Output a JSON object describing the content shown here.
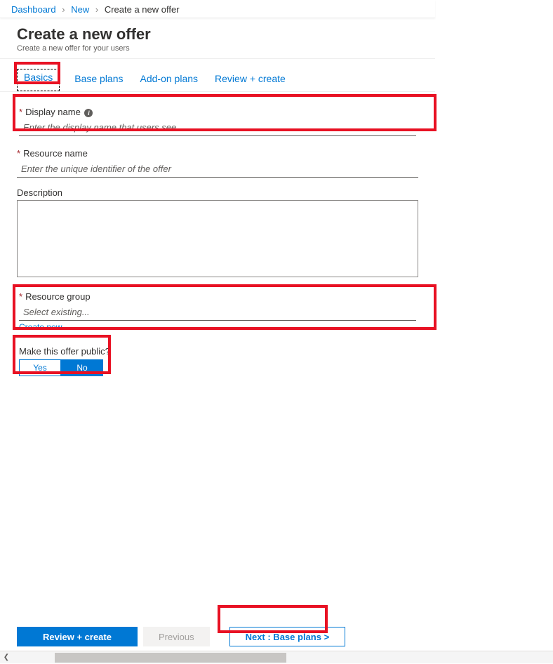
{
  "breadcrumb": {
    "items": [
      "Dashboard",
      "New",
      "Create a new offer"
    ]
  },
  "header": {
    "title": "Create a new offer",
    "subtitle": "Create a new offer for your users"
  },
  "tabs": [
    "Basics",
    "Base plans",
    "Add-on plans",
    "Review + create"
  ],
  "form": {
    "displayName": {
      "label": "Display name",
      "placeholder": "Enter the display name that users see"
    },
    "resourceName": {
      "label": "Resource name",
      "placeholder": "Enter the unique identifier of the offer"
    },
    "description": {
      "label": "Description"
    },
    "resourceGroup": {
      "label": "Resource group",
      "placeholder": "Select existing...",
      "createNew": "Create new"
    },
    "makePublic": {
      "label": "Make this offer public?",
      "yes": "Yes",
      "no": "No"
    }
  },
  "footer": {
    "review": "Review + create",
    "previous": "Previous",
    "next": "Next : Base plans >"
  },
  "infoGlyph": "i"
}
